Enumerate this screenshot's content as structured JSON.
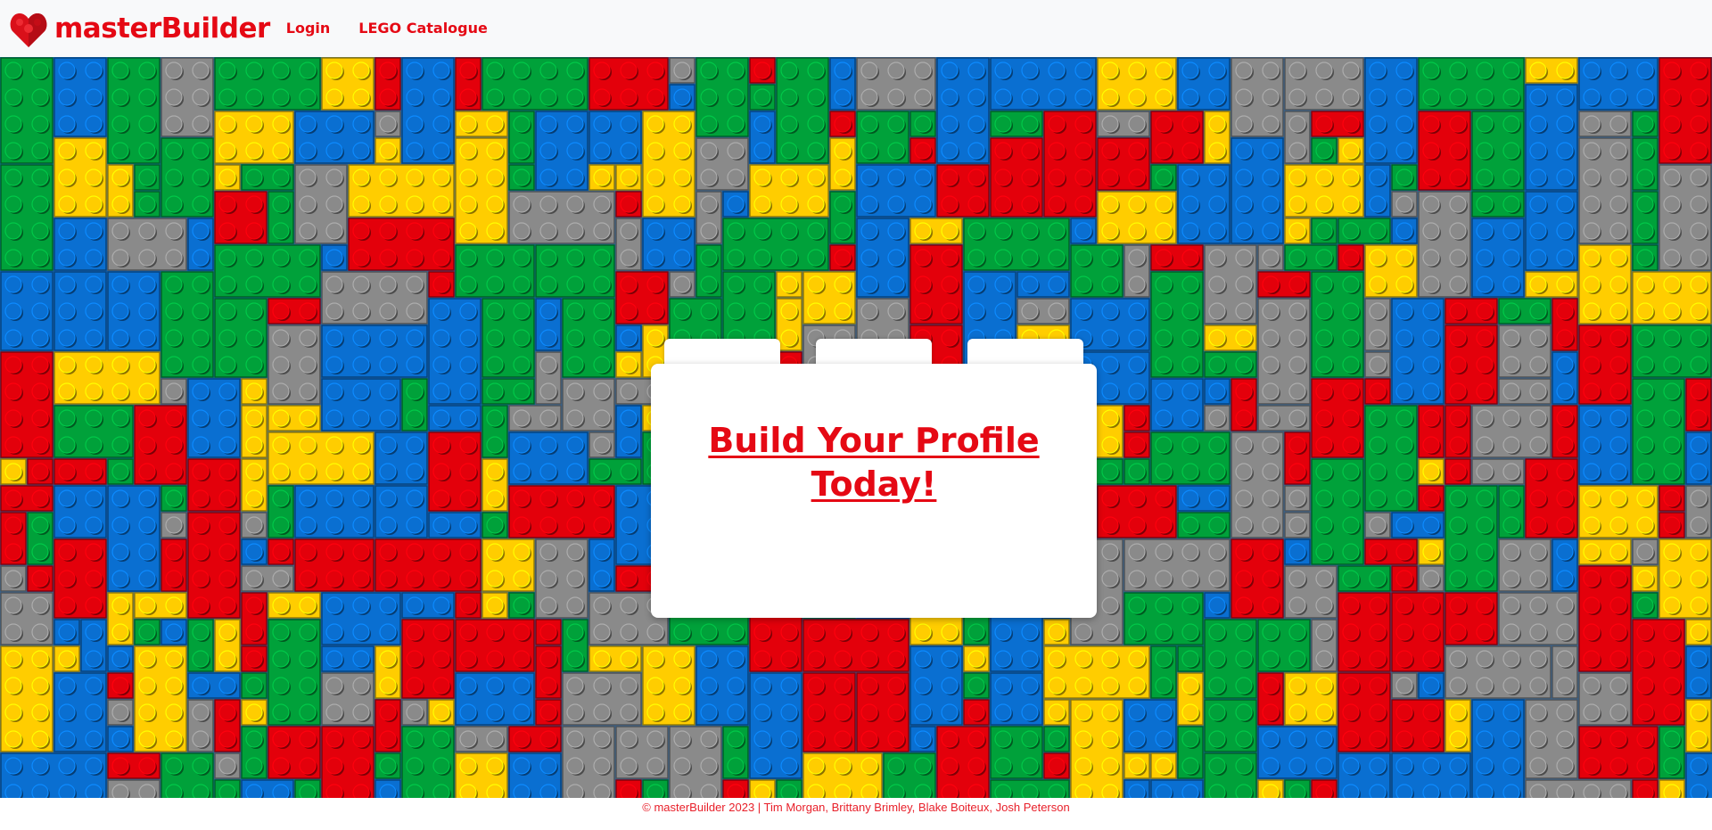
{
  "brand": {
    "name": "masterBuilder",
    "logo_icon": "lego-heart-icon",
    "color": "#e50914"
  },
  "nav": {
    "login_label": "Login",
    "catalogue_label": "LEGO Catalogue"
  },
  "hero": {
    "background": "lego-bricks-pattern",
    "brick_colors": [
      "#e3000b",
      "#0a6fd1",
      "#00a13a",
      "#ffcd00",
      "#8a8a8a"
    ]
  },
  "card": {
    "title": "Build Your Profile Today!"
  },
  "footer": {
    "text": "© masterBuilder 2023 | Tim Morgan, Brittany Brimley, Blake Boiteux, Josh Peterson"
  }
}
